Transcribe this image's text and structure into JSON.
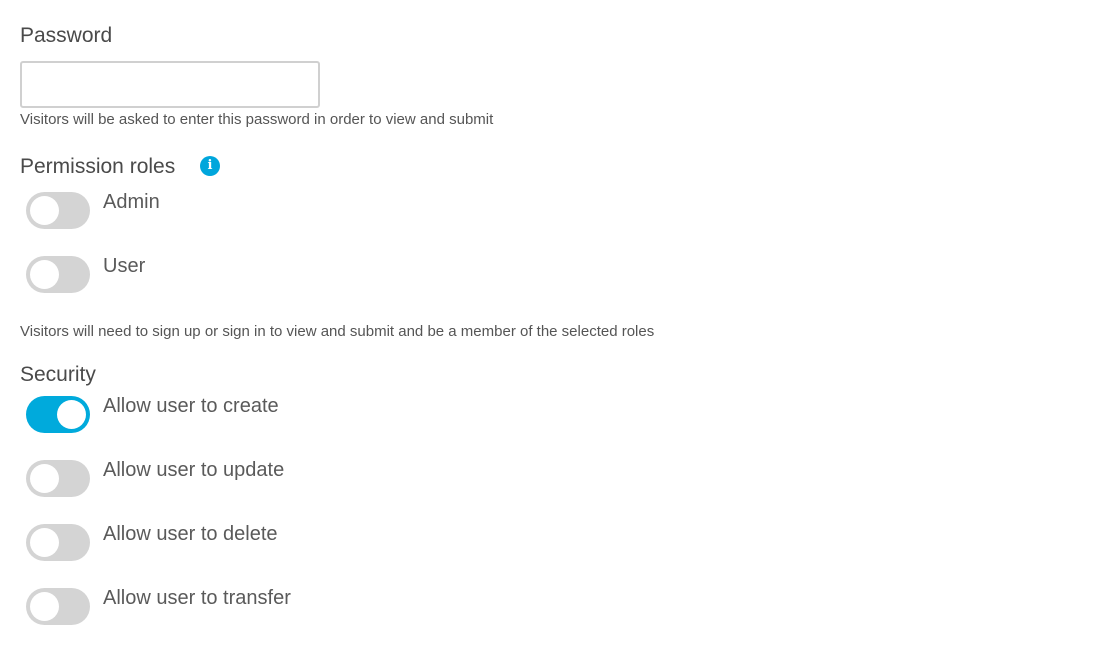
{
  "password": {
    "label": "Password",
    "value": "",
    "placeholder": "",
    "help": "Visitors will be asked to enter this password in order to view and submit"
  },
  "permission_roles": {
    "label": "Permission roles",
    "info_icon": "info-icon",
    "roles": [
      {
        "label": "Admin",
        "enabled": false
      },
      {
        "label": "User",
        "enabled": false
      }
    ],
    "help": "Visitors will need to sign up or sign in to view and submit and be a member of the selected roles"
  },
  "security": {
    "label": "Security",
    "options": [
      {
        "label": "Allow user to create",
        "enabled": true
      },
      {
        "label": "Allow user to update",
        "enabled": false
      },
      {
        "label": "Allow user to delete",
        "enabled": false
      },
      {
        "label": "Allow user to transfer",
        "enabled": false
      }
    ]
  },
  "colors": {
    "accent": "#00aadc",
    "toggle_off": "#d4d4d4",
    "text": "#4a4a4a"
  }
}
